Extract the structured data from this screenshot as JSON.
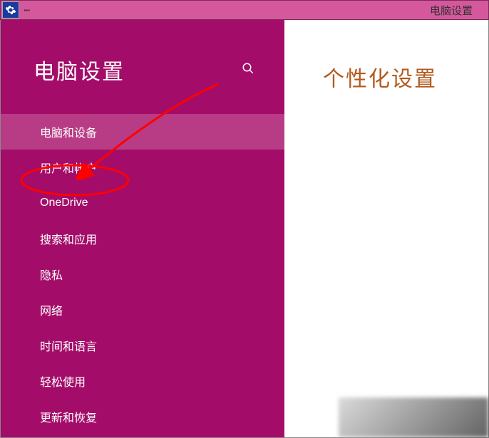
{
  "titlebar": {
    "dots": "∙∙∙",
    "app_title": "电脑设置"
  },
  "sidebar": {
    "title": "电脑设置",
    "items": [
      {
        "label": "电脑和设备",
        "selected": true
      },
      {
        "label": "用户和帐户",
        "selected": false
      },
      {
        "label": "OneDrive",
        "selected": false
      },
      {
        "label": "搜索和应用",
        "selected": false
      },
      {
        "label": "隐私",
        "selected": false
      },
      {
        "label": "网络",
        "selected": false
      },
      {
        "label": "时间和语言",
        "selected": false
      },
      {
        "label": "轻松使用",
        "selected": false
      },
      {
        "label": "更新和恢复",
        "selected": false
      }
    ]
  },
  "content": {
    "title": "个性化设置"
  },
  "annotation": {
    "highlight_item_index": 1,
    "color": "#ff0000"
  }
}
